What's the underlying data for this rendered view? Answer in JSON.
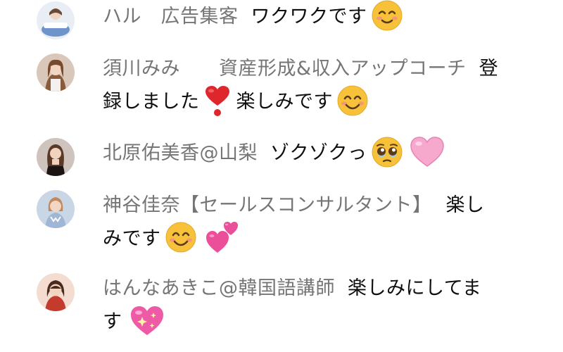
{
  "messages": [
    {
      "author": "ハル　広告集客",
      "text": "ワクワクです",
      "emojis": [
        "smiling-face-icon"
      ],
      "avatar_colors": {
        "bg": "#e9eef5",
        "figure": "#6e94c9"
      }
    },
    {
      "author": "須川みみ　　資産形成&収入アップコーチ",
      "text_line1": "登",
      "text_line2_part1": "録しました",
      "text_line2_part2": "楽しみです",
      "emojis": [
        "red-heart-exclamation-icon",
        "smiling-face-icon"
      ],
      "avatar_colors": {
        "bg": "#d9c7b9",
        "figure": "#8a5a3c"
      }
    },
    {
      "author": "北原佑美香@山梨",
      "text": "ゾクゾクっ",
      "emojis": [
        "pleading-face-icon",
        "pink-heart-icon"
      ],
      "avatar_colors": {
        "bg": "#cfc3bd",
        "figure": "#3a2a24"
      }
    },
    {
      "author": "神谷佳奈【セールスコンサルタント】",
      "text_line1": "楽し",
      "text_line2": "みです",
      "emojis": [
        "smiling-face-icon",
        "two-hearts-icon"
      ],
      "avatar_colors": {
        "bg": "#c9d6e6",
        "figure": "#d9a981"
      }
    },
    {
      "author": "はんなあきこ@韓国語講師",
      "text_line1": "楽しみにしてま",
      "text_line2": "す",
      "emojis": [
        "sparkling-heart-icon"
      ],
      "avatar_colors": {
        "bg": "#f4dcd0",
        "figure": "#c43a2c"
      }
    }
  ]
}
